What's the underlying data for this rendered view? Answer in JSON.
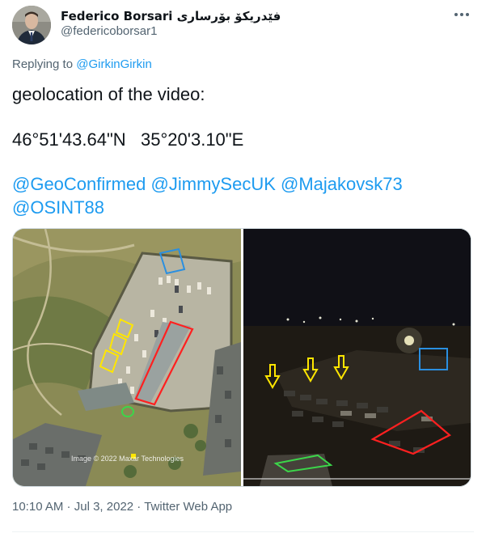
{
  "author": {
    "name": "Federico Borsari فێدریکۆ بۆرساری",
    "handle": "@federicoborsar1"
  },
  "reply": {
    "prefix": "Replying to",
    "to": "@GirkinGirkin"
  },
  "tweet": {
    "line1": "geolocation of the video:",
    "coords": "46°51'43.64\"N   35°20'3.10\"E",
    "mentions": [
      "@GeoConfirmed",
      "@JimmySecUK",
      "@Majakovsk73",
      "@OSINT88"
    ]
  },
  "media": {
    "left_image": {
      "watermark": "Image © 2022 Maxar Technologies"
    }
  },
  "meta": {
    "time": "10:10 AM",
    "sep1": " · ",
    "date": "Jul 3, 2022",
    "sep2": " · ",
    "source": "Twitter Web App"
  },
  "colors": {
    "link": "#1d9bf0",
    "secondary_text": "#536471",
    "text": "#0f1419",
    "marker_red": "#ff2020",
    "marker_yellow": "#ffe600",
    "marker_blue": "#2a8fe0",
    "marker_green": "#3cd64a"
  },
  "icons": {
    "more": "more-horizontal-icon",
    "arrow": "down-arrow-icon"
  }
}
